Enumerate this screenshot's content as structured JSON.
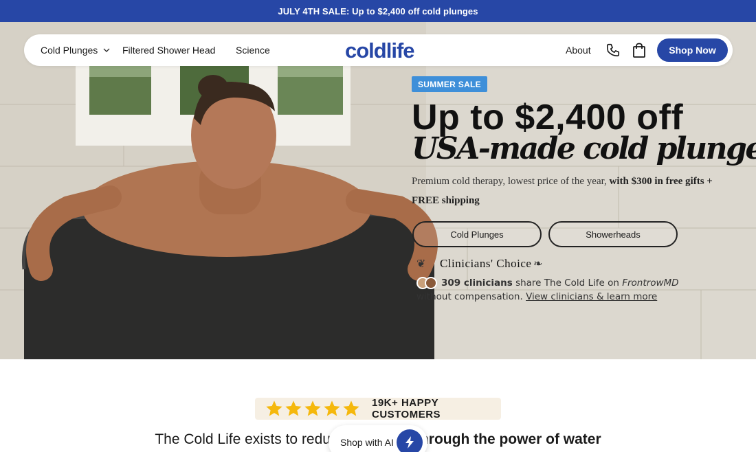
{
  "promo": {
    "text": "JULY 4TH SALE: Up to $2,400 off cold plunges"
  },
  "nav": {
    "links": [
      {
        "label": "Cold Plunges"
      },
      {
        "label": "Filtered Shower Head"
      },
      {
        "label": "Science"
      }
    ],
    "logo": "coldlife",
    "about": "About",
    "shop_now": "Shop Now"
  },
  "hero": {
    "badge": "SUMMER SALE",
    "headline": "Up to $2,400 off",
    "subheadline": "USA-made cold plunges",
    "description_plain": "Premium cold therapy, lowest price of the year,",
    "description_bold": "with $300 in free gifts + FREE shipping",
    "buttons": [
      {
        "label": "Cold Plunges"
      },
      {
        "label": "Showerheads"
      }
    ]
  },
  "clinicians": {
    "title": "Clinicians' Choice",
    "count_text": "309 clinicians",
    "text_mid": "share The Cold Life on",
    "brand": "FrontrowMD",
    "text_end": "without compensation.",
    "link": "View clinicians & learn more"
  },
  "rating": {
    "stars": 5,
    "text": "19K+ HAPPY CUSTOMERS",
    "star_color": "#f5b80c"
  },
  "mission": {
    "text_start": "The Cold Life exists to redu",
    "text_bold": "hrough the power of water"
  },
  "ai_widget": {
    "label": "Shop with AI"
  },
  "colors": {
    "brand": "#2747a6",
    "badge": "#3e8fd9"
  }
}
